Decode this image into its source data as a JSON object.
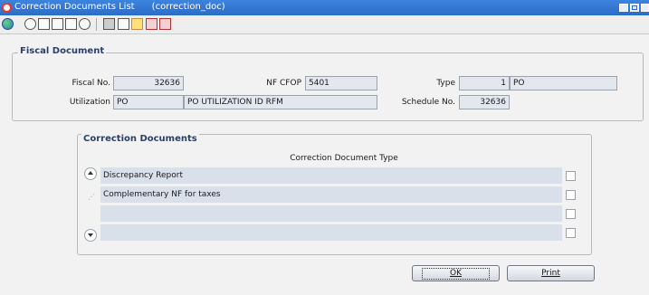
{
  "window": {
    "title": "Correction Documents List",
    "window_id": "(correction_doc)"
  },
  "toolbar": {
    "icons": [
      "globe-icon",
      "help-icon",
      "spell-check-icon",
      "calendar-icon",
      "print-icon",
      "hint-icon",
      "grid-icon",
      "check-icon",
      "warning-icon",
      "user-icon",
      "alert-icon"
    ]
  },
  "fiscal_document": {
    "group_label": "Fiscal Document",
    "fiscal_no_label": "Fiscal No.",
    "fiscal_no_value": "32636",
    "nf_cfop_label": "NF CFOP",
    "nf_cfop_value": "5401",
    "type_label": "Type",
    "type_code": "1",
    "type_value": "PO",
    "utilization_label": "Utilization",
    "utilization_code": "PO",
    "utilization_desc": "PO UTILIZATION ID RFM",
    "schedule_no_label": "Schedule No.",
    "schedule_no_value": "32636"
  },
  "correction_documents": {
    "group_label": "Correction Documents",
    "column_header": "Correction Document Type",
    "rows": [
      {
        "label": "Discrepancy Report",
        "checked": false
      },
      {
        "label": "Complementary NF for taxes",
        "checked": false
      },
      {
        "label": "",
        "checked": false
      },
      {
        "label": "",
        "checked": false
      }
    ]
  },
  "buttons": {
    "ok_label": "OK",
    "print_label": "Print"
  }
}
